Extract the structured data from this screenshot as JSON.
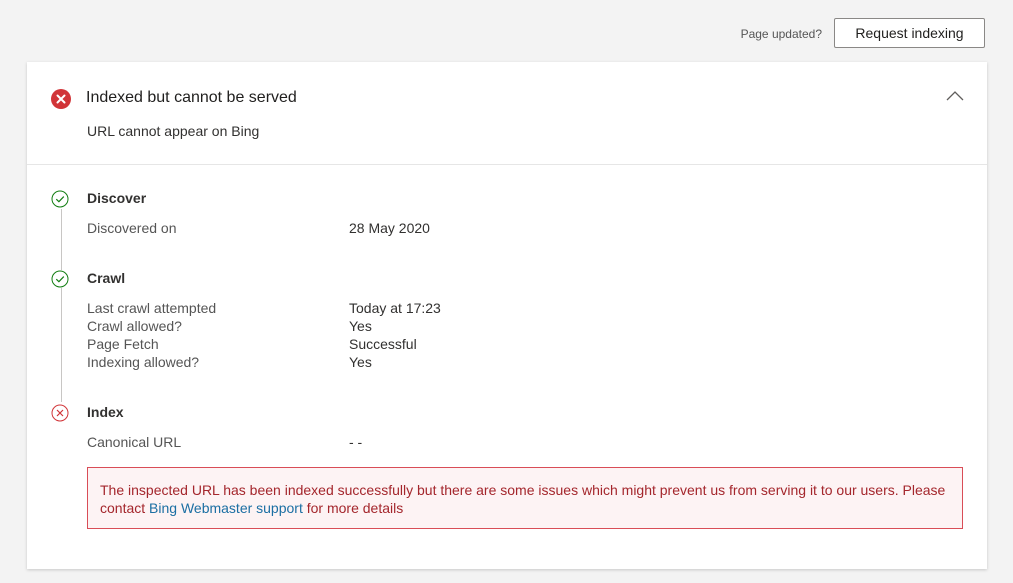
{
  "toolbar": {
    "page_updated_label": "Page updated?",
    "request_indexing_label": "Request indexing"
  },
  "status": {
    "title": "Indexed but cannot be served",
    "subtitle": "URL cannot appear on Bing",
    "icon": "error-circle-filled-icon",
    "color": "#d13438"
  },
  "steps": [
    {
      "title": "Discover",
      "status": "success",
      "icon": "checkmark-circle-icon",
      "rows": [
        {
          "label": "Discovered on",
          "value": "28 May 2020"
        }
      ]
    },
    {
      "title": "Crawl",
      "status": "success",
      "icon": "checkmark-circle-icon",
      "rows": [
        {
          "label": "Last crawl attempted",
          "value": "Today at 17:23"
        },
        {
          "label": "Crawl allowed?",
          "value": "Yes"
        },
        {
          "label": "Page Fetch",
          "value": "Successful"
        },
        {
          "label": "Indexing allowed?",
          "value": "Yes"
        }
      ]
    },
    {
      "title": "Index",
      "status": "error",
      "icon": "error-circle-icon",
      "rows": [
        {
          "label": "Canonical URL",
          "value": "- -"
        }
      ]
    }
  ],
  "alert": {
    "text_before": "The inspected URL has been indexed successfully but there are some issues which might prevent us from serving it to our users. Please contact ",
    "link_text": "Bing Webmaster support",
    "text_after": " for more details"
  },
  "colors": {
    "success": "#107c10",
    "error": "#d13438",
    "link": "#1b6fa3"
  }
}
